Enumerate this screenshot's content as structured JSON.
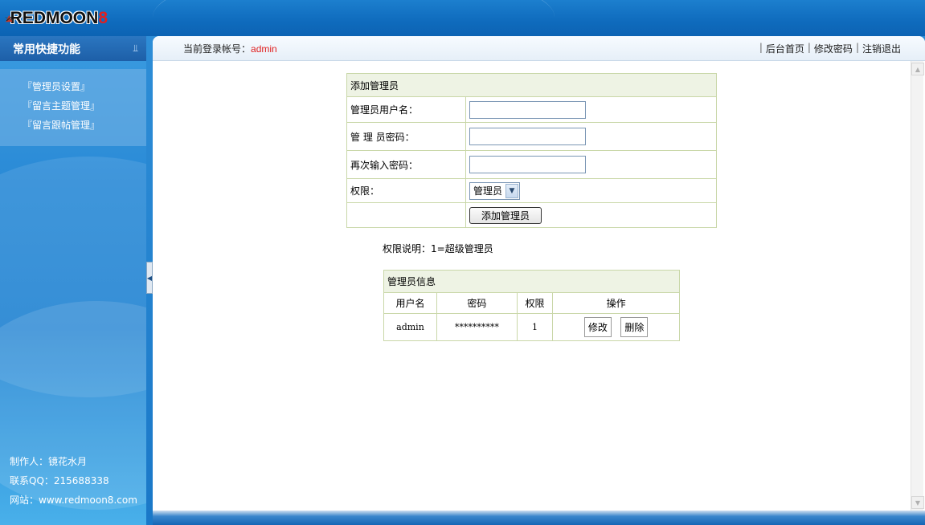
{
  "logo": {
    "text": "REDMOON",
    "number": "8"
  },
  "sidebar": {
    "title": "常用快捷功能",
    "items": [
      {
        "label": "『管理员设置』"
      },
      {
        "label": "『留言主题管理』"
      },
      {
        "label": "『留言跟帖管理』"
      }
    ],
    "footer": {
      "author": "制作人：镜花水月",
      "qq": "联系QQ：215688338",
      "site": "网站：www.redmoon8.com"
    }
  },
  "header": {
    "login_label": "当前登录帐号：",
    "login_user": "admin",
    "links": [
      {
        "label": "后台首页"
      },
      {
        "label": "修改密码"
      },
      {
        "label": "注销退出"
      }
    ]
  },
  "add_form": {
    "title": "添加管理员",
    "username_label": "管理员用户名：",
    "username_value": "",
    "password_label": "管 理 员密码：",
    "password_value": "",
    "confirm_label": "再次输入密码：",
    "confirm_value": "",
    "permission_label": "权限：",
    "permission_value": "管理员",
    "submit_label": "添加管理员"
  },
  "permission_note": "权限说明：1=超级管理员",
  "admin_table": {
    "title": "管理员信息",
    "columns": [
      "用户名",
      "密码",
      "权限",
      "操作"
    ],
    "rows": [
      {
        "username": "admin",
        "password": "**********",
        "permission": "1",
        "edit": "修改",
        "delete": "删除"
      }
    ]
  }
}
